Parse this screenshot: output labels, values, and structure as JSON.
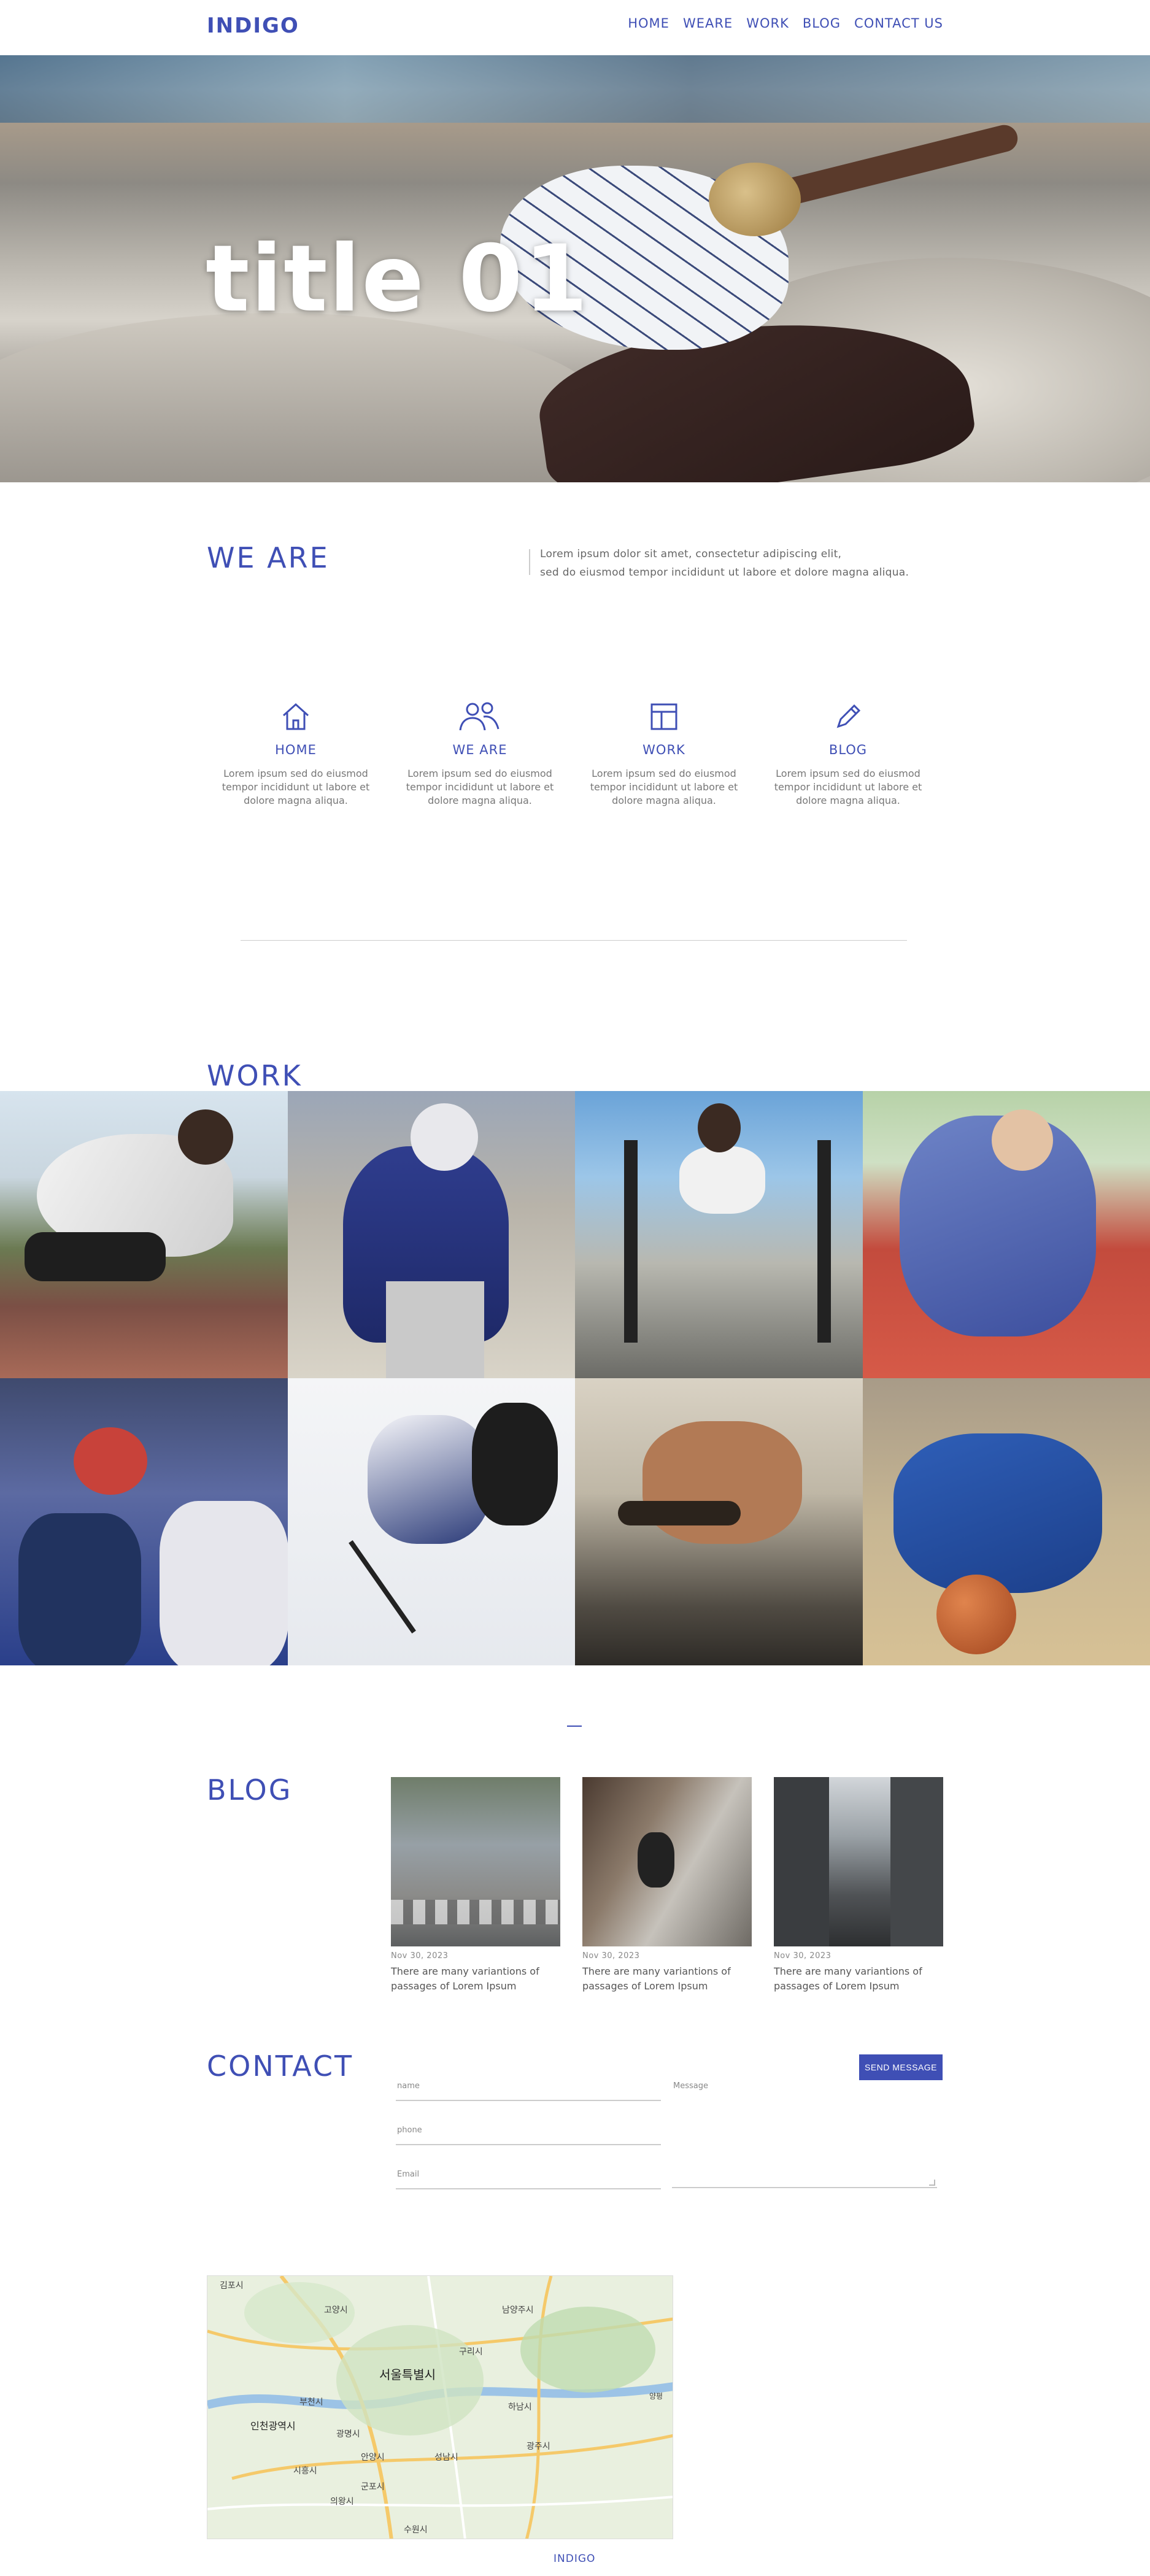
{
  "brand": "INDIGO",
  "nav": [
    "HOME",
    "WEARE",
    "WORK",
    "BLOG",
    "CONTACT US"
  ],
  "hero": {
    "title": "title 01"
  },
  "weare": {
    "title": "WE ARE",
    "text_line1": "Lorem ipsum dolor sit amet, consectetur adipiscing elit,",
    "text_line2": "sed do eiusmod tempor incididunt ut labore et dolore magna aliqua."
  },
  "features": [
    {
      "icon": "home-icon",
      "label": "HOME",
      "desc": "Lorem ipsum sed do eiusmod tempor incididunt ut labore et dolore magna aliqua."
    },
    {
      "icon": "people-icon",
      "label": "WE ARE",
      "desc": "Lorem ipsum sed do eiusmod tempor incididunt ut labore et dolore magna aliqua."
    },
    {
      "icon": "layout-icon",
      "label": "WORK",
      "desc": "Lorem ipsum sed do eiusmod tempor incididunt ut labore et dolore magna aliqua."
    },
    {
      "icon": "pencil-icon",
      "label": "BLOG",
      "desc": "Lorem ipsum sed do eiusmod tempor incididunt ut labore et dolore magna aliqua."
    }
  ],
  "work": {
    "title": "WORK"
  },
  "blog": {
    "title": "BLOG",
    "posts": [
      {
        "date": "Nov 30, 2023",
        "text": "There are many variantions of passages of Lorem Ipsum"
      },
      {
        "date": "Nov 30, 2023",
        "text": "There are many variantions of passages of Lorem Ipsum"
      },
      {
        "date": "Nov 30, 2023",
        "text": "There are many variantions of passages of Lorem Ipsum"
      }
    ]
  },
  "contact": {
    "title": "CONTACT",
    "send_label": "SEND MESSAGE",
    "name_placeholder": "name",
    "phone_placeholder": "phone",
    "email_placeholder": "Email",
    "message_placeholder": "Message"
  },
  "map": {
    "labels": [
      "김포시",
      "고양시",
      "남양주시",
      "서울특별시",
      "구리시",
      "부천시",
      "인천광역시",
      "광명시",
      "하남시",
      "안양시",
      "성남시",
      "광주시",
      "시흥시",
      "군포시",
      "수원시",
      "의왕시",
      "양평"
    ]
  },
  "footer": {
    "brand": "INDIGO"
  }
}
